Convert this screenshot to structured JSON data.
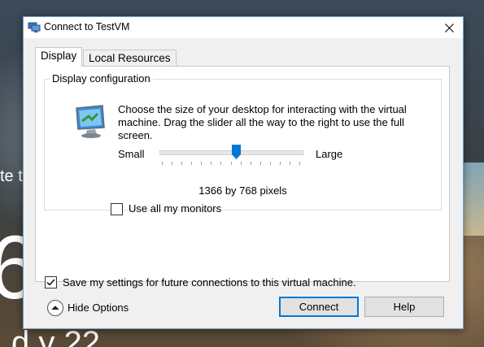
{
  "window": {
    "title": "Connect to TestVM"
  },
  "tabs": [
    {
      "label": "Display",
      "selected": true
    },
    {
      "label": "Local Resources",
      "selected": false
    }
  ],
  "display_config": {
    "legend": "Display configuration",
    "description": "Choose the size of your desktop for interacting with the virtual machine. Drag the slider all the way to the right to use the full screen.",
    "slider_min_label": "Small",
    "slider_max_label": "Large",
    "slider_level": 0.53,
    "resolution_text": "1366 by 768 pixels",
    "use_all_monitors": {
      "label": "Use all my monitors",
      "checked": false
    }
  },
  "save_settings": {
    "label": "Save my settings for future connections to this virtual machine.",
    "checked": true
  },
  "footer": {
    "hide_options_label": "Hide Options",
    "connect_label": "Connect",
    "help_label": "Help"
  },
  "icons": {
    "app": "remote-desktop-icon",
    "close": "close-icon",
    "monitor": "monitor-icon",
    "hide_options": "chevron-up-circle-icon"
  },
  "colors": {
    "accent": "#0078d7",
    "window_bg": "#f0f0f0",
    "panel_bg": "#ffffff"
  },
  "lock_screen_fragments": [
    "te t",
    "6",
    "d y 22"
  ]
}
